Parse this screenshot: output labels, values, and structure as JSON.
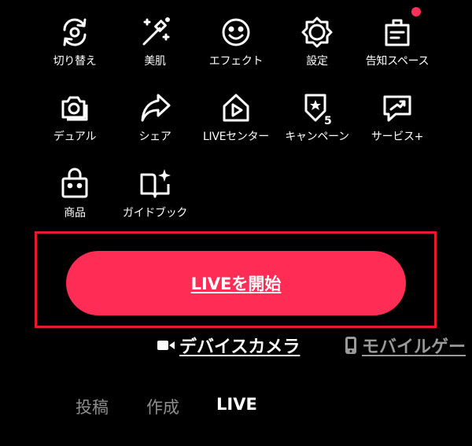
{
  "tools": [
    {
      "label": "切り替え",
      "icon": "camera-switch-icon"
    },
    {
      "label": "美肌",
      "icon": "magic-wand-icon"
    },
    {
      "label": "エフェクト",
      "icon": "smiley-icon"
    },
    {
      "label": "設定",
      "icon": "gear-icon"
    },
    {
      "label": "告知スペース",
      "icon": "notice-board-icon"
    },
    {
      "label": "デュアル",
      "icon": "dual-camera-icon"
    },
    {
      "label": "シェア",
      "icon": "share-arrow-icon"
    },
    {
      "label": "LIVEセンター",
      "icon": "live-center-house-icon"
    },
    {
      "label": "キャンペーン",
      "icon": "campaign-badge-icon"
    },
    {
      "label": "サービス+",
      "icon": "service-chat-icon"
    },
    {
      "label": "商品",
      "icon": "shopping-bag-icon"
    },
    {
      "label": "ガイドブック",
      "icon": "guidebook-icon"
    }
  ],
  "campaign_badge_number": "5",
  "start_button": {
    "label": "LIVEを開始"
  },
  "sources": {
    "device_camera": {
      "label": "デバイスカメラ",
      "icon": "video-camera-icon"
    },
    "mobile_game": {
      "label": "モバイルゲー",
      "icon": "phone-icon"
    }
  },
  "tabs": [
    {
      "label": "投稿",
      "active": false
    },
    {
      "label": "作成",
      "active": false
    },
    {
      "label": "LIVE",
      "active": true
    }
  ],
  "colors": {
    "accent": "#ff2d55",
    "highlight_frame": "#e8182e",
    "background": "#000000",
    "inactive_text": "#8e8e8e"
  }
}
